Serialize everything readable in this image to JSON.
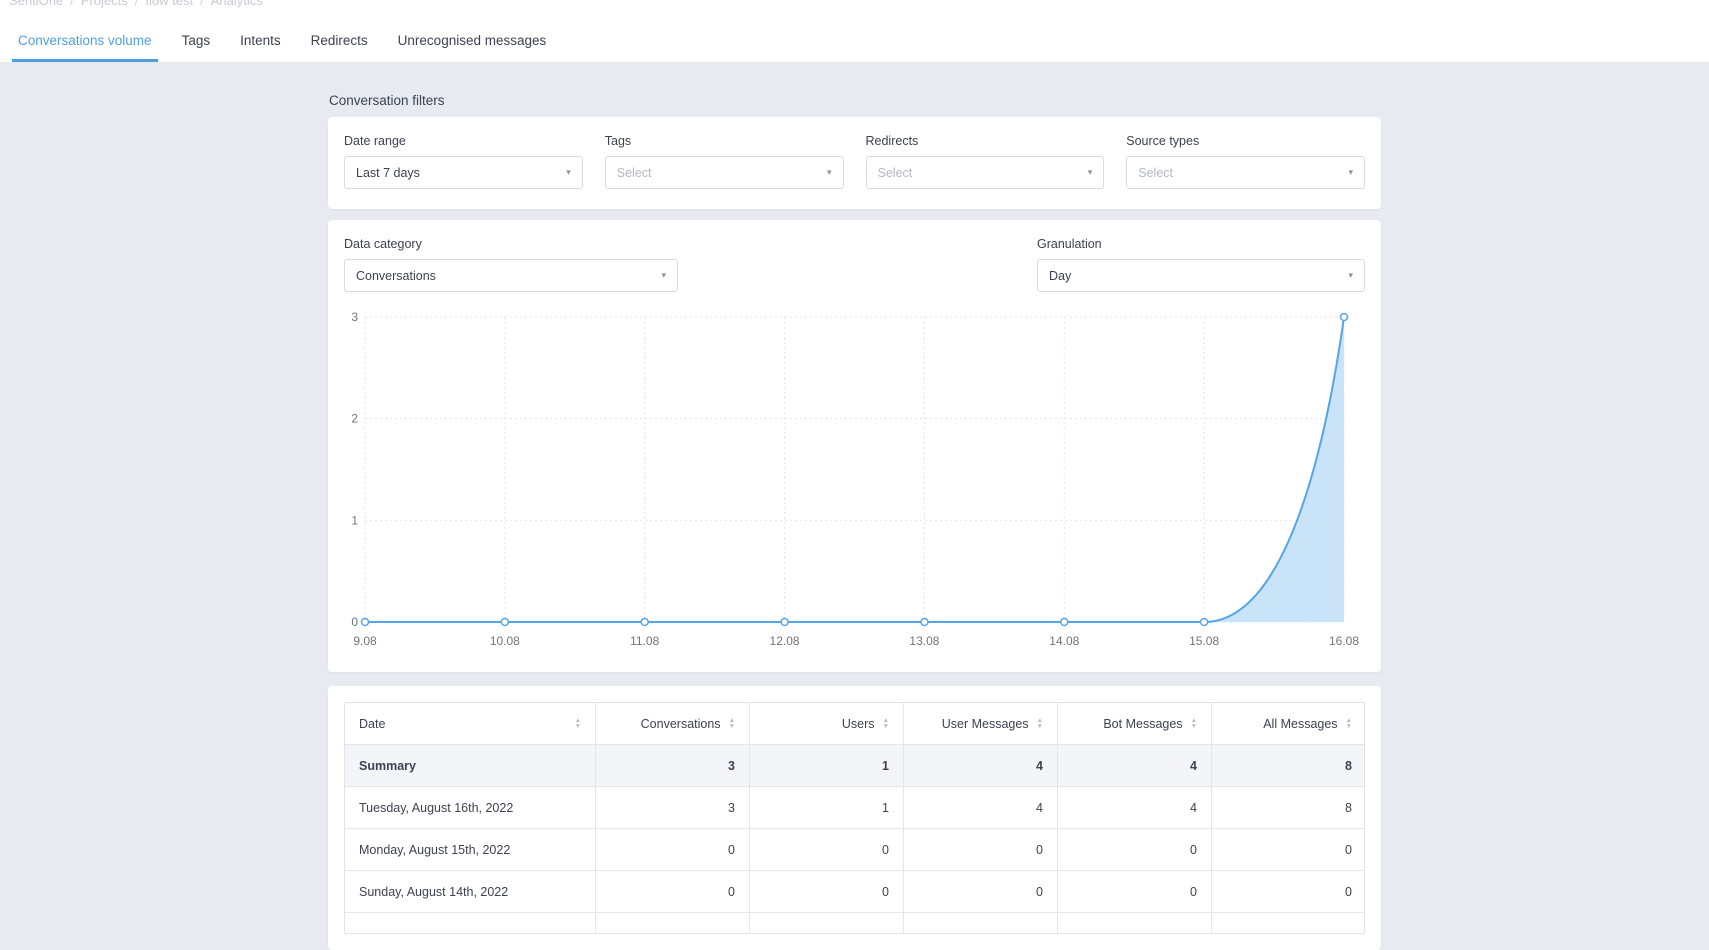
{
  "breadcrumb": {
    "separator": "/",
    "items": [
      "SentiOne",
      "Projects",
      "flow test",
      "Analytics"
    ]
  },
  "tabs": [
    {
      "label": "Conversations volume",
      "active": true
    },
    {
      "label": "Tags",
      "active": false
    },
    {
      "label": "Intents",
      "active": false
    },
    {
      "label": "Redirects",
      "active": false
    },
    {
      "label": "Unrecognised messages",
      "active": false
    }
  ],
  "filters": {
    "section_label": "Conversation filters",
    "fields": [
      {
        "label": "Date range",
        "value": "Last 7 days",
        "placeholder": false
      },
      {
        "label": "Tags",
        "value": "Select",
        "placeholder": true
      },
      {
        "label": "Redirects",
        "value": "Select",
        "placeholder": true
      },
      {
        "label": "Source types",
        "value": "Select",
        "placeholder": true
      }
    ]
  },
  "chart_card": {
    "data_category": {
      "label": "Data category",
      "value": "Conversations"
    },
    "granulation": {
      "label": "Granulation",
      "value": "Day"
    }
  },
  "chart_data": {
    "type": "area",
    "title": "",
    "xlabel": "",
    "ylabel": "",
    "x": [
      "9.08",
      "10.08",
      "11.08",
      "12.08",
      "13.08",
      "14.08",
      "15.08",
      "16.08"
    ],
    "series": [
      {
        "name": "Conversations",
        "values": [
          0,
          0,
          0,
          0,
          0,
          0,
          0,
          3
        ]
      }
    ],
    "ylim": [
      0,
      3
    ],
    "yticks": [
      0,
      1,
      2,
      3
    ],
    "grid": true,
    "legend_position": "none",
    "line_color": "#55a5e8",
    "fill_color": "#c9e3f8"
  },
  "table": {
    "columns": [
      "Date",
      "Conversations",
      "Users",
      "User Messages",
      "Bot Messages",
      "All Messages"
    ],
    "rows": [
      {
        "date": "Summary",
        "values": [
          3,
          1,
          4,
          4,
          8
        ],
        "bold": true
      },
      {
        "date": "Tuesday, August 16th, 2022",
        "values": [
          3,
          1,
          4,
          4,
          8
        ],
        "bold": false
      },
      {
        "date": "Monday, August 15th, 2022",
        "values": [
          0,
          0,
          0,
          0,
          0
        ],
        "bold": false
      },
      {
        "date": "Sunday, August 14th, 2022",
        "values": [
          0,
          0,
          0,
          0,
          0
        ],
        "bold": false
      }
    ]
  }
}
